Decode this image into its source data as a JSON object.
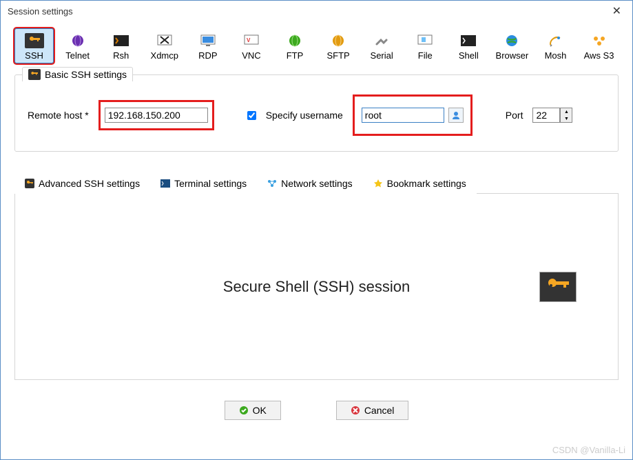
{
  "window": {
    "title": "Session settings"
  },
  "toolbar": [
    {
      "label": "SSH",
      "selected": true
    },
    {
      "label": "Telnet"
    },
    {
      "label": "Rsh"
    },
    {
      "label": "Xdmcp"
    },
    {
      "label": "RDP"
    },
    {
      "label": "VNC"
    },
    {
      "label": "FTP"
    },
    {
      "label": "SFTP"
    },
    {
      "label": "Serial"
    },
    {
      "label": "File"
    },
    {
      "label": "Shell"
    },
    {
      "label": "Browser"
    },
    {
      "label": "Mosh"
    },
    {
      "label": "Aws S3"
    }
  ],
  "basic": {
    "legend": "Basic SSH settings",
    "hostLabel": "Remote host *",
    "hostValue": "192.168.150.200",
    "specifyLabel": "Specify username",
    "specifyChecked": true,
    "userValue": "root",
    "portLabel": "Port",
    "portValue": "22"
  },
  "tabs": [
    {
      "label": "Advanced SSH settings"
    },
    {
      "label": "Terminal settings"
    },
    {
      "label": "Network settings"
    },
    {
      "label": "Bookmark settings"
    }
  ],
  "content": {
    "title": "Secure Shell (SSH) session"
  },
  "buttons": {
    "ok": "OK",
    "cancel": "Cancel"
  },
  "watermark": "CSDN @Vanilla-Li"
}
